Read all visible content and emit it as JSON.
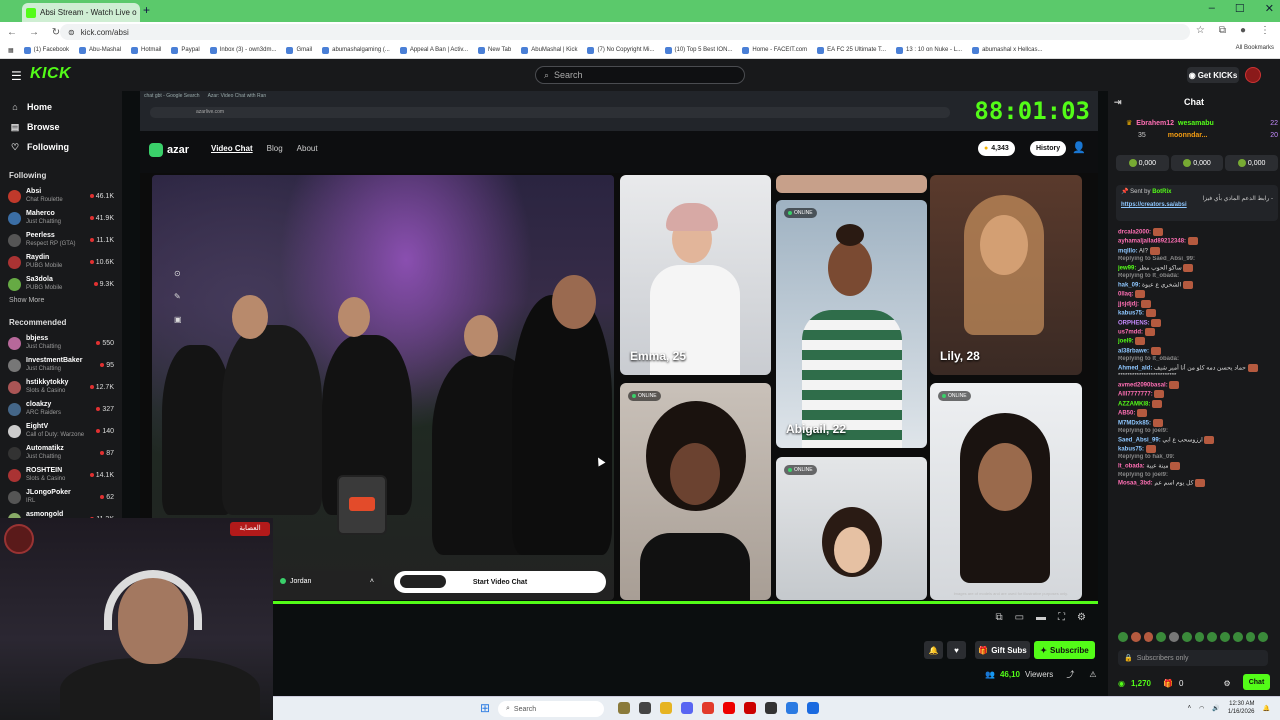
{
  "browser": {
    "tab_title": "Absi Stream - Watch Live o",
    "tab_close": "×",
    "new_tab": "+",
    "url": "kick.com/absi",
    "window_controls": [
      "–",
      "☐",
      "✕"
    ],
    "bookmarks": [
      {
        "label": "(1) Facebook"
      },
      {
        "label": "Abu-Mashal"
      },
      {
        "label": "Hotmail"
      },
      {
        "label": "Paypal"
      },
      {
        "label": "Inbox (3) - own3dm..."
      },
      {
        "label": "Gmail"
      },
      {
        "label": "abumashalgaming (..."
      },
      {
        "label": "Appeal A Ban | Activ..."
      },
      {
        "label": "New Tab"
      },
      {
        "label": "AbuMashal | Kick"
      },
      {
        "label": "(7) No Copyright Mi..."
      },
      {
        "label": "(10) Top 5 Best ION..."
      },
      {
        "label": "Home - FACEIT.com"
      },
      {
        "label": "EA FC 25 Ultimate T..."
      },
      {
        "label": "13 : 10 on Nuke - L..."
      },
      {
        "label": "abumashal x Hellcas..."
      }
    ],
    "all_bookmarks": "All Bookmarks"
  },
  "header": {
    "logo": "KICK",
    "search_placeholder": "Search",
    "get_kicks": "Get KICKs"
  },
  "sidebar": {
    "nav": [
      {
        "label": "Home",
        "icon": "home-icon",
        "glyph": "⌂"
      },
      {
        "label": "Browse",
        "icon": "browse-icon",
        "glyph": "▤"
      },
      {
        "label": "Following",
        "icon": "heart-icon",
        "glyph": "♡"
      }
    ],
    "following_title": "Following",
    "following": [
      {
        "name": "Absi",
        "category": "Chat Roulette",
        "viewers": "46.1K",
        "color": "#c0392b"
      },
      {
        "name": "Maherco",
        "category": "Just Chatting",
        "viewers": "41.9K",
        "color": "#3b6ea5"
      },
      {
        "name": "Peerless",
        "category": "Respect RP (GTA)",
        "viewers": "11.1K",
        "color": "#555"
      },
      {
        "name": "Raydin",
        "category": "PUBG Mobile",
        "viewers": "10.6K",
        "color": "#a33"
      },
      {
        "name": "Sa3dola",
        "category": "PUBG Mobile",
        "viewers": "9.3K",
        "color": "#6a4"
      }
    ],
    "show_more": "Show More",
    "recommended_title": "Recommended",
    "recommended": [
      {
        "name": "bbjess",
        "category": "Just Chatting",
        "viewers": "550",
        "color": "#b7689a"
      },
      {
        "name": "InvestmentBaker",
        "category": "Just Chatting",
        "viewers": "95",
        "color": "#777"
      },
      {
        "name": "hstikkytokky",
        "category": "Slots & Casino",
        "viewers": "12.7K",
        "color": "#a55"
      },
      {
        "name": "cloakzy",
        "category": "ARC Raiders",
        "viewers": "327",
        "color": "#468"
      },
      {
        "name": "EightV",
        "category": "Call of Duty: Warzone",
        "viewers": "140",
        "color": "#ccc"
      },
      {
        "name": "Automatikz",
        "category": "Just Chatting",
        "viewers": "87",
        "color": "#333"
      },
      {
        "name": "ROSHTEIN",
        "category": "Slots & Casino",
        "viewers": "14.1K",
        "color": "#a33"
      },
      {
        "name": "JLongoPoker",
        "category": "IRL",
        "viewers": "62",
        "color": "#555"
      },
      {
        "name": "asmongold",
        "category": "Just Chatting",
        "viewers": "11.3K",
        "color": "#8a6"
      }
    ]
  },
  "stream": {
    "timer": "88:01:03",
    "inner_tabs": [
      "chat gbt - Google Search",
      "Azar: Video Chat with Ran"
    ],
    "inner_url": "azarlive.com",
    "azar": {
      "logo": "azar",
      "nav": [
        "Video Chat",
        "Blog",
        "About"
      ],
      "coins": "4,343",
      "history": "History",
      "jordan": "Jordan",
      "start_button": "Start Video Chat",
      "online_badge": "ONLINE",
      "cards": [
        {
          "name": "Emma, 25"
        },
        {
          "name": "Abigail, 22"
        },
        {
          "name": "Lily, 28"
        }
      ],
      "disclaimer": "Images are of models and are used for illustrative purposes only."
    },
    "webcam_banner": "العصابة"
  },
  "actions": {
    "gift_subs": "Gift Subs",
    "subscribe": "Subscribe",
    "viewers_count": "46,10",
    "viewers_label": "Viewers"
  },
  "chat": {
    "title": "Chat",
    "top_gifters": [
      {
        "user": "Ebrahem12",
        "count": "35"
      },
      {
        "user": "wesamabu",
        "count": "22"
      },
      {
        "user": "moonndar...",
        "count": "20"
      }
    ],
    "pinned": [
      "0,000",
      "0,000",
      "0,000"
    ],
    "sent_by_label": "Sent by",
    "sent_by_user": "BotRix",
    "sent_by_text": "رابط الدعم المادي بأي فيزا -",
    "sent_by_link": "https://creators.sa/absi",
    "messages": [
      {
        "user": "drcala2000:",
        "color": "#ff6fb4",
        "text": ""
      },
      {
        "user": "ayhamaljallad89212348:",
        "color": "#ff6fb4",
        "text": ""
      },
      {
        "user": "mqlllo:",
        "color": "#8ec7ff",
        "text": "AI?"
      },
      {
        "user": "Replying to Saed_Absi_99:",
        "color": "#888",
        "text": ""
      },
      {
        "user": "jew99:",
        "color": "#53fc18",
        "text": "ساكو الحوب مطر"
      },
      {
        "user": "Replying to lt_obada:",
        "color": "#888",
        "text": ""
      },
      {
        "user": "hak_09:",
        "color": "#8ec7ff",
        "text": "الشخري ع عبوة"
      },
      {
        "user": "0llaq:",
        "color": "#ff6fb4",
        "text": ""
      },
      {
        "user": "jjsjdjdj:",
        "color": "#ff6fb4",
        "text": ""
      },
      {
        "user": "kabus75:",
        "color": "#8ec7ff",
        "text": ""
      },
      {
        "user": "ORPHENS:",
        "color": "#c58bff",
        "text": ""
      },
      {
        "user": "us7mdd:",
        "color": "#ff6fb4",
        "text": ""
      },
      {
        "user": "joel9:",
        "color": "#53fc18",
        "text": ""
      },
      {
        "user": "al38rbawe:",
        "color": "#8ec7ff",
        "text": ""
      },
      {
        "user": "Replying to lt_obada:",
        "color": "#888",
        "text": ""
      },
      {
        "user": "Ahmed_ald:",
        "color": "#8ec7ff",
        "text": "حماد يحسن دمه كلو من أنا أمير شيف"
      },
      {
        "user": "",
        "color": "#ddd",
        "text": "*************************"
      },
      {
        "user": "avmed2090basal:",
        "color": "#ff6fb4",
        "text": ""
      },
      {
        "user": "Alll7777777:",
        "color": "#ff6fb4",
        "text": ""
      },
      {
        "user": "AZZAMKI8:",
        "color": "#53fc18",
        "text": ""
      },
      {
        "user": "AB50:",
        "color": "#ff6fb4",
        "text": ""
      },
      {
        "user": "M7MDxk85:",
        "color": "#8ec7ff",
        "text": ""
      },
      {
        "user": "Replying to joel9:",
        "color": "#888",
        "text": ""
      },
      {
        "user": "Saed_Absi_99:",
        "color": "#8ec7ff",
        "text": "ارزوسحب ع ابي"
      },
      {
        "user": "kabus75:",
        "color": "#8ec7ff",
        "text": ""
      },
      {
        "user": "Replying to hak_09:",
        "color": "#888",
        "text": ""
      },
      {
        "user": "lt_obada:",
        "color": "#ff6fb4",
        "text": "مينة عيبة"
      },
      {
        "user": "Replying to joel9:",
        "color": "#888",
        "text": ""
      },
      {
        "user": "Mosaa_3bd:",
        "color": "#ff6fb4",
        "text": "كل يوم اسم عم"
      }
    ],
    "input_placeholder": "Subscribers only",
    "kicks": "1,270",
    "gifts": "0",
    "chat_button": "Chat"
  },
  "taskbar": {
    "search": "Search",
    "time": "12:30 AM",
    "date": "1/16/2026"
  },
  "colors": {
    "accent": "#53fc18",
    "sidebar_bg": "#18191b",
    "page_bg": "#0b0e0f"
  }
}
